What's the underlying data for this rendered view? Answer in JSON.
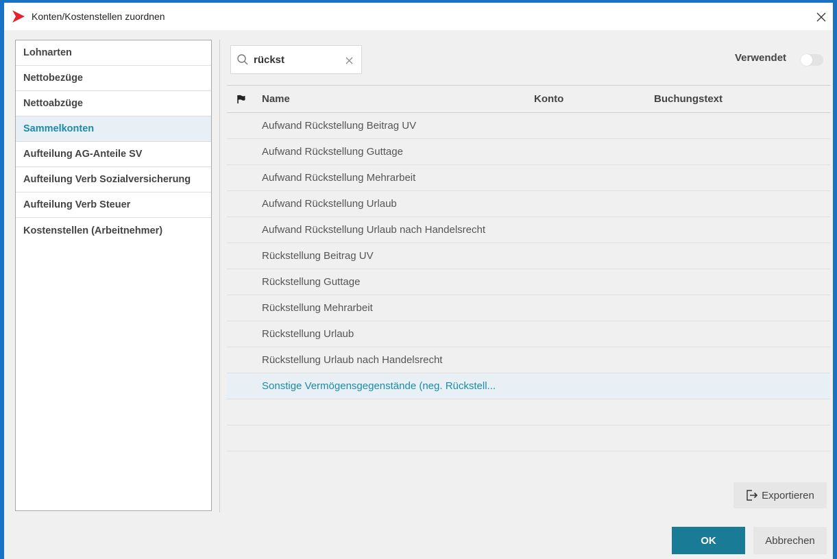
{
  "window": {
    "title": "Konten/Kostenstellen zuordnen",
    "accent_color": "#1a72c4",
    "logo_color": "#e3232d"
  },
  "sidebar": {
    "items": [
      {
        "label": "Lohnarten",
        "active": false
      },
      {
        "label": "Nettobezüge",
        "active": false
      },
      {
        "label": "Nettoabzüge",
        "active": false
      },
      {
        "label": "Sammelkonten",
        "active": true
      },
      {
        "label": "Aufteilung AG-Anteile SV",
        "active": false
      },
      {
        "label": "Aufteilung Verb Sozialversicherung",
        "active": false
      },
      {
        "label": "Aufteilung Verb Steuer",
        "active": false
      },
      {
        "label": "Kostenstellen (Arbeitnehmer)",
        "active": false
      }
    ]
  },
  "search": {
    "value": "rückst",
    "icon": "search-icon",
    "clear_icon": "close-icon"
  },
  "filter": {
    "used_label": "Verwendet",
    "used_enabled": false
  },
  "table": {
    "headers": {
      "flag_icon": "flag-icon",
      "name": "Name",
      "konto": "Konto",
      "text": "Buchungstext"
    },
    "rows": [
      {
        "name": "Aufwand Rückstellung Beitrag UV",
        "konto": "",
        "text": ""
      },
      {
        "name": "Aufwand Rückstellung Guttage",
        "konto": "",
        "text": ""
      },
      {
        "name": "Aufwand Rückstellung Mehrarbeit",
        "konto": "",
        "text": ""
      },
      {
        "name": "Aufwand Rückstellung Urlaub",
        "konto": "",
        "text": ""
      },
      {
        "name": "Aufwand Rückstellung Urlaub nach Handelsrecht",
        "konto": "",
        "text": ""
      },
      {
        "name": "Rückstellung Beitrag UV",
        "konto": "",
        "text": ""
      },
      {
        "name": "Rückstellung Guttage",
        "konto": "",
        "text": ""
      },
      {
        "name": "Rückstellung Mehrarbeit",
        "konto": "",
        "text": ""
      },
      {
        "name": "Rückstellung Urlaub",
        "konto": "",
        "text": ""
      },
      {
        "name": "Rückstellung Urlaub nach Handelsrecht",
        "konto": "",
        "text": ""
      },
      {
        "name": "Sonstige Vermögensgegenstände (neg. Rückstell...",
        "konto": "",
        "text": ""
      }
    ],
    "selected_index": 10
  },
  "buttons": {
    "export_label": "Exportieren",
    "ok_label": "OK",
    "cancel_label": "Abbrechen"
  },
  "colors": {
    "primary": "#1a7b96",
    "selected_text": "#1b8ba6",
    "selected_bg": "#e8f0f6"
  }
}
